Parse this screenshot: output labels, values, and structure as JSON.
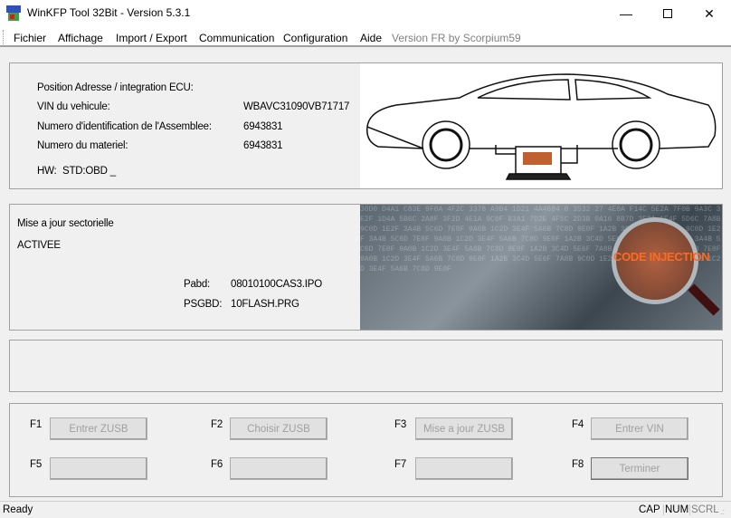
{
  "window": {
    "title": "WinKFP Tool 32Bit - Version 5.3.1",
    "controls": [
      "minimize",
      "maximize",
      "close"
    ]
  },
  "menu": {
    "items": [
      "Fichier",
      "Affichage",
      "Import / Export",
      "Communication",
      "Configuration",
      "Aide"
    ],
    "version_note": "Version FR by Scorpium59"
  },
  "ecu_panel": {
    "position_label": "Position Adresse / integration ECU:",
    "vin_label": "VIN du vehicule:",
    "vin_value": "WBAVC31090VB71717",
    "assembly_label": "Numero d'identification de l'Assemblee:",
    "assembly_value": "6943831",
    "hardware_label": "Numero du materiel:",
    "hardware_value": "6943831",
    "hw_label": "HW:",
    "hw_value": "STD:OBD _"
  },
  "update_panel": {
    "title": "Mise a jour sectorielle",
    "status": "ACTIVEE",
    "pabd_label": "Pabd:",
    "pabd_value": "08010100CAS3.IPO",
    "psgbd_label": "PSGBD:",
    "psgbd_value": "10FLASH.PRG",
    "image_text": "CODE INJECTION"
  },
  "function_keys": [
    {
      "key": "F1",
      "label": "Entrer ZUSB"
    },
    {
      "key": "F2",
      "label": "Choisir ZUSB"
    },
    {
      "key": "F3",
      "label": "Mise a jour ZUSB"
    },
    {
      "key": "F4",
      "label": "Entrer VIN"
    },
    {
      "key": "F5",
      "label": ""
    },
    {
      "key": "F6",
      "label": ""
    },
    {
      "key": "F7",
      "label": ""
    },
    {
      "key": "F8",
      "label": "Terminer"
    }
  ],
  "statusbar": {
    "status": "Ready",
    "indicators": [
      "CAP",
      "NUM",
      "SCRL"
    ]
  }
}
